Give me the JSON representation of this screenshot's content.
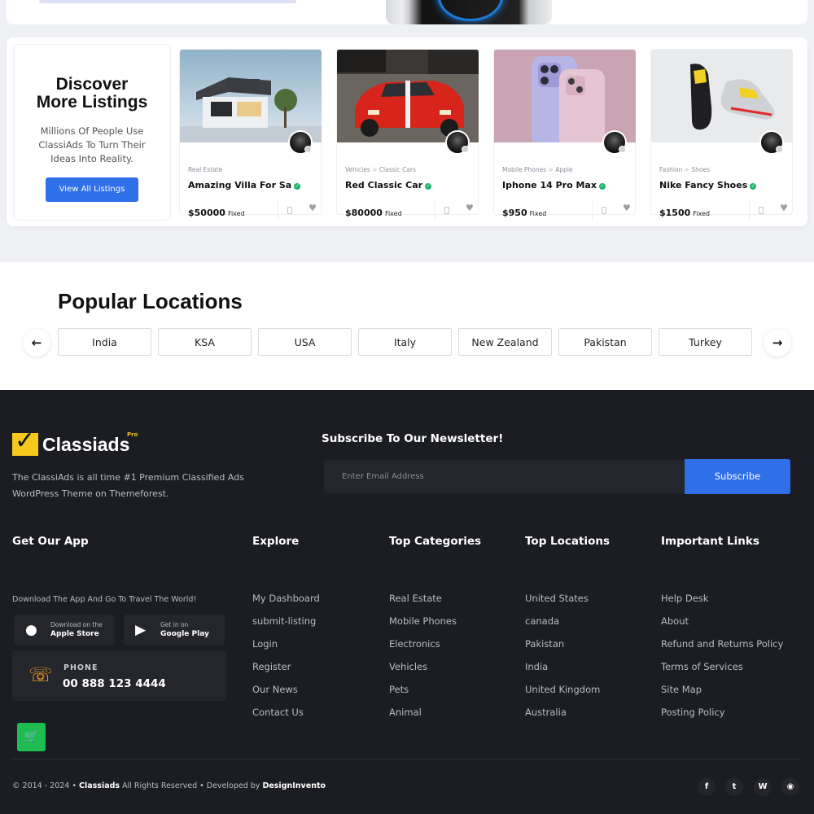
{
  "discover": {
    "title_line1": "Discover",
    "title_line2": "More Listings",
    "description": "Millions Of People Use ClassiAds To Turn Their Ideas Into Reality.",
    "button": "View All Listings"
  },
  "listings": [
    {
      "cat1": "Real Estate",
      "cat2": "",
      "title": "Amazing Villa For Sa",
      "price": "$50000",
      "price_type": "Fixed"
    },
    {
      "cat1": "Vehicles",
      "cat2": "Classic Cars",
      "title": "Red Classic Car",
      "price": "$80000",
      "price_type": "Fixed"
    },
    {
      "cat1": "Mobile Phones",
      "cat2": "Apple",
      "title": "Iphone 14 Pro Max",
      "price": "$950",
      "price_type": "Fixed"
    },
    {
      "cat1": "Fashion",
      "cat2": "Shoes",
      "title": "Nike Fancy Shoes",
      "price": "$1500",
      "price_type": "Fixed"
    }
  ],
  "popular": {
    "title": "Popular Locations",
    "locations": [
      "India",
      "KSA",
      "USA",
      "Italy",
      "New Zealand",
      "Pakistan",
      "Turkey"
    ]
  },
  "footer": {
    "logo_text": "Classiads",
    "logo_badge": "Pro",
    "about": "The ClassiAds is all time #1 Premium Classified Ads WordPress Theme on Themeforest.",
    "newsletter_title": "Subscribe To Our Newsletter!",
    "email_placeholder": "Enter Email Address",
    "subscribe_label": "Subscribe",
    "app": {
      "heading": "Get Our App",
      "text": "Download The App And Go To Travel The World!",
      "apple_line1": "Download on the",
      "apple_line2": "Apple Store",
      "google_line1": "Get in on",
      "google_line2": "Google Play",
      "phone_label": "PHONE",
      "phone_number": "00 888 123 4444"
    },
    "explore": {
      "heading": "Explore",
      "items": [
        "My Dashboard",
        "submit-listing",
        "Login",
        "Register",
        "Our News",
        "Contact Us"
      ]
    },
    "categories": {
      "heading": "Top Categories",
      "items": [
        "Real Estate",
        "Mobile Phones",
        "Electronics",
        "Vehicles",
        "Pets",
        "Animal"
      ]
    },
    "locations": {
      "heading": "Top Locations",
      "items": [
        "United States",
        "canada",
        "Pakistan",
        "India",
        "United Kingdom",
        "Australia"
      ]
    },
    "links": {
      "heading": "Important Links",
      "items": [
        "Help Desk",
        "About",
        "Refund and Returns Policy",
        "Terms of Services",
        "Site Map",
        "Posting Policy"
      ]
    },
    "copyright_pre": "© 2014 - 2024 •",
    "copyright_brand": "Classiads",
    "copyright_mid": "All Rights Reserved • Developed by",
    "copyright_dev": "DesignInvento"
  },
  "icons": {
    "verified": "verified-check-icon",
    "compare": "compare-icon",
    "favorite": "heart-icon",
    "prev": "arrow-left-icon",
    "next": "arrow-right-icon",
    "apple": "apple-icon",
    "google_play": "google-play-icon",
    "phone": "phone-icon",
    "cart": "cart-icon",
    "social": [
      "facebook-icon",
      "twitter-icon",
      "wordpress-icon",
      "github-icon"
    ]
  },
  "colors": {
    "accent": "#2f6fe8",
    "footer_bg": "#1c1d22",
    "verified": "#1fb36a",
    "logo_yellow": "#f6c91c",
    "cart_green": "#1ebd52",
    "phone_orange": "#f59f1c"
  }
}
